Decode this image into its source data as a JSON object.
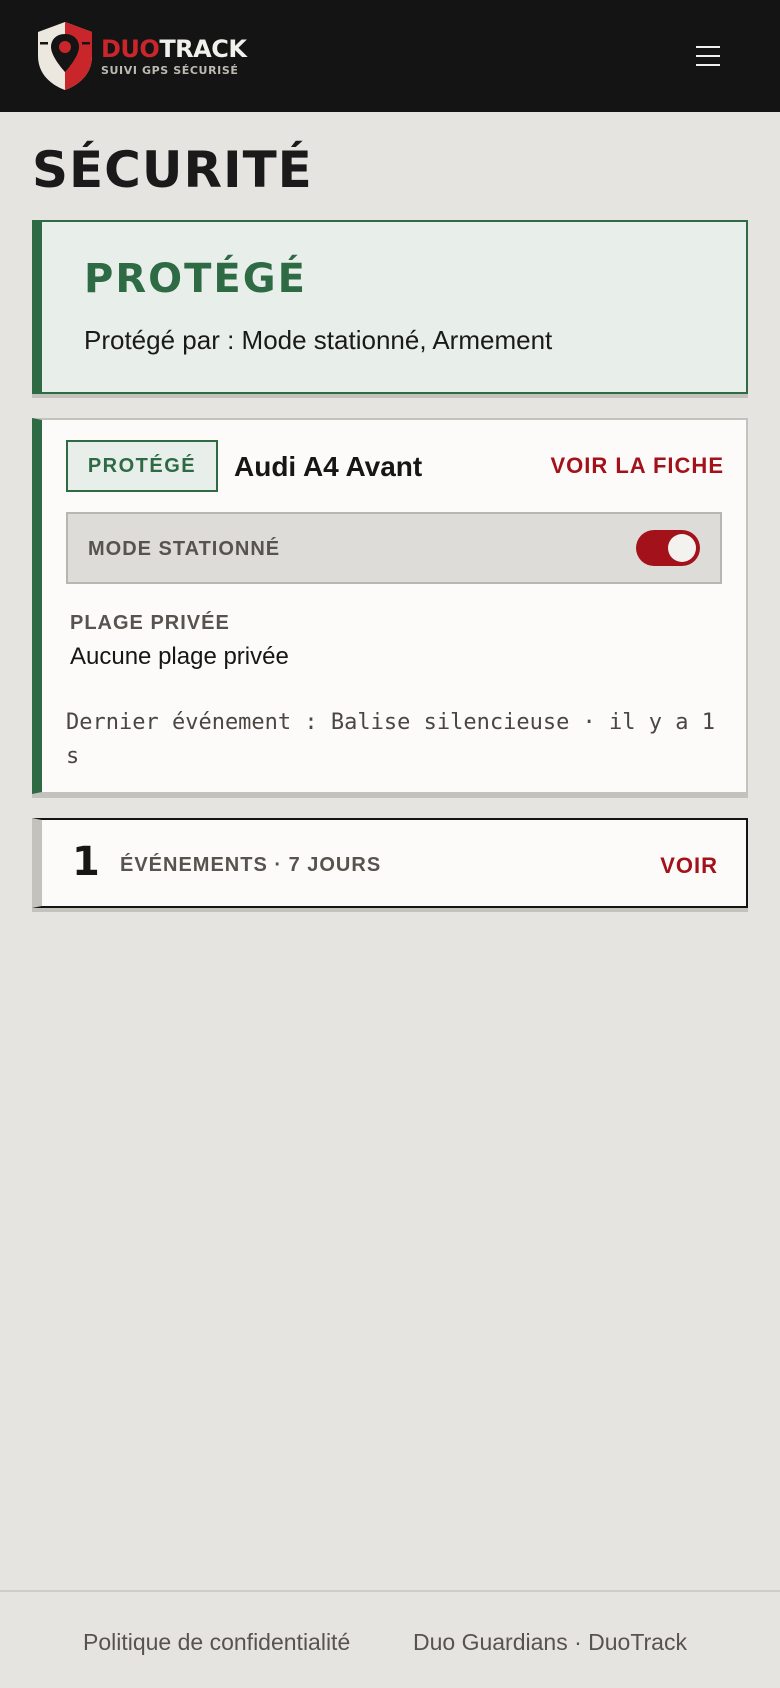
{
  "header": {
    "brand_primary": "DUO",
    "brand_secondary": "TRACK",
    "brand_tagline": "SUIVI GPS SÉCURISÉ",
    "logo_icon": "shield-location-pin-icon",
    "menu_icon": "hamburger-menu-icon"
  },
  "page": {
    "title": "SÉCURITÉ"
  },
  "status": {
    "title": "PROTÉGÉ",
    "description": "Protégé par : Mode stationné, Armement",
    "color": "#2e6b44"
  },
  "vehicle": {
    "badge": "PROTÉGÉ",
    "name": "Audi A4 Avant",
    "link_label": "VOIR LA FICHE",
    "mode_label": "MODE STATIONNÉ",
    "mode_enabled": true,
    "privacy_label": "PLAGE PRIVÉE",
    "privacy_value": "Aucune plage privée",
    "last_event": "Dernier événement : Balise silencieuse · il y a 1 s"
  },
  "events": {
    "count": "1",
    "label": "ÉVÉNEMENTS · 7 JOURS",
    "link_label": "VOIR"
  },
  "footer": {
    "privacy_link": "Politique de confidentialité",
    "credit": "Duo Guardians · DuoTrack"
  },
  "colors": {
    "accent_red": "#a3121a",
    "header_bg": "#141414",
    "page_bg": "#e6e4e0"
  }
}
